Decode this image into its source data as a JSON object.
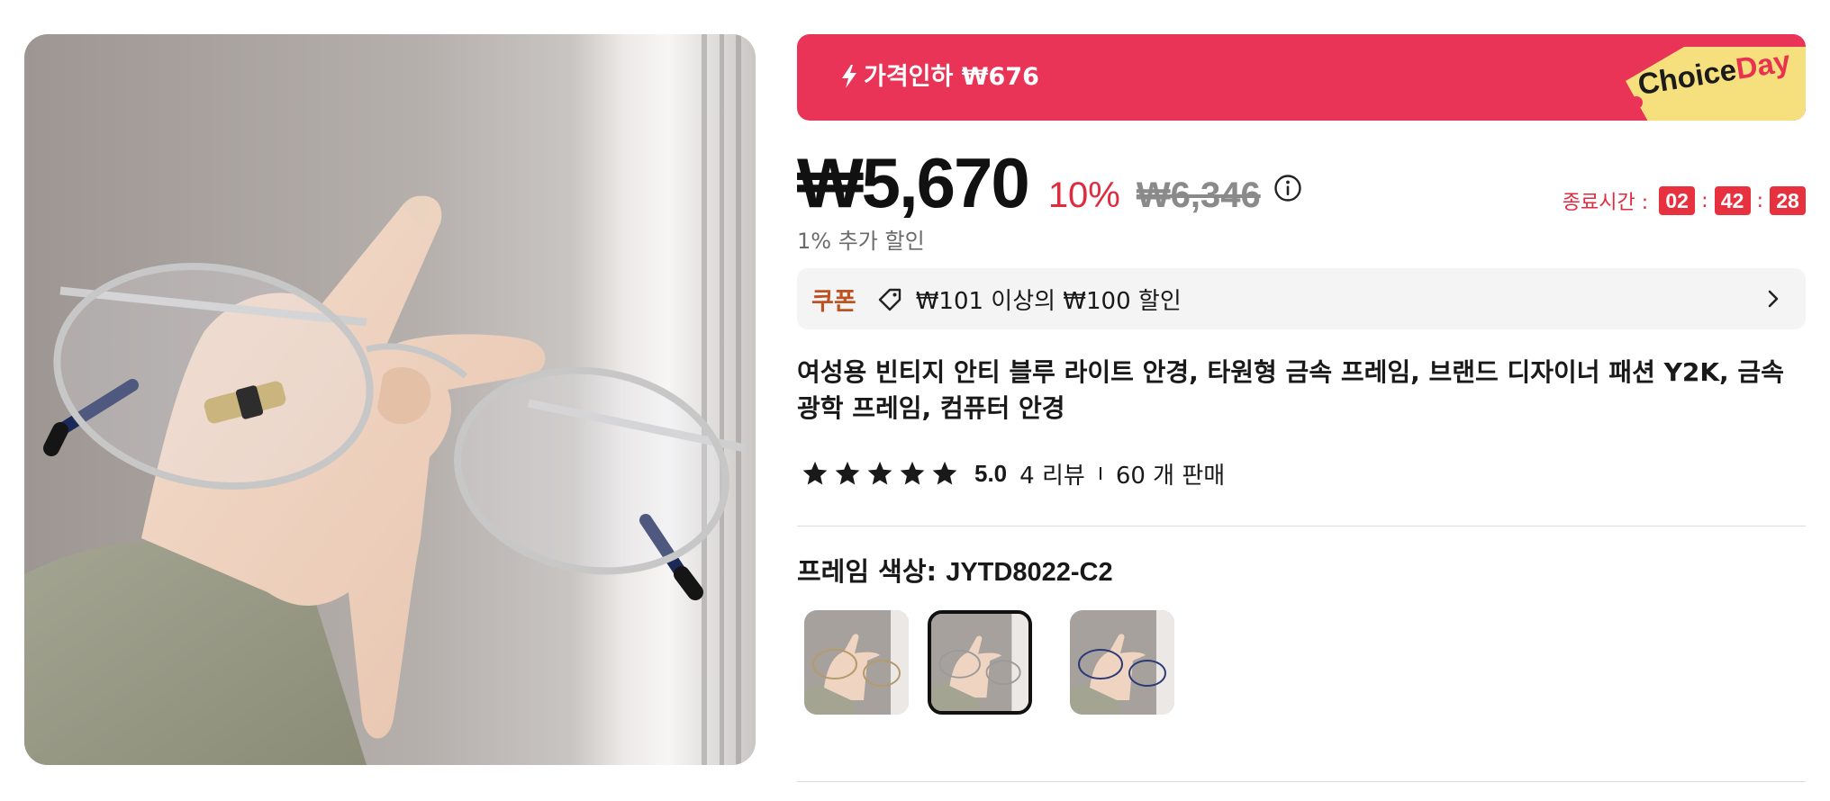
{
  "promo": {
    "text": "가격인하 ₩676",
    "brand_part1": "Choice",
    "brand_part2": "Day",
    "color": "#ea3457"
  },
  "price": {
    "current": "₩5,670",
    "discount_percent": "10%",
    "original": "₩6,346",
    "extra_discount": "1% 추가 할인"
  },
  "countdown": {
    "label": "종료시간 :",
    "hours": "02",
    "minutes": "42",
    "seconds": "28"
  },
  "coupon": {
    "title": "쿠폰",
    "text": "₩101 이상의 ₩100 할인"
  },
  "product": {
    "title": "여성용 빈티지 안티 블루 라이트 안경, 타원형 금속 프레임, 브랜드 디자이너 패션 Y2K, 금속 광학 프레임, 컴퓨터 안경"
  },
  "rating": {
    "stars": 5,
    "score": "5.0",
    "reviews": "4 리뷰",
    "sold": "60 개 판매"
  },
  "variant": {
    "label": "프레임 색상: ",
    "value": "JYTD8022-C2",
    "selected_index": 1,
    "swatches": [
      {
        "frame_color": "#b59a6a"
      },
      {
        "frame_color": "#9a9a9a"
      },
      {
        "frame_color": "#2c3a78"
      }
    ]
  },
  "icons": {
    "bolt": "bolt-icon",
    "info": "info-icon",
    "coupon": "tag-icon",
    "chevron": "chevron-right-icon",
    "star": "star-icon"
  }
}
